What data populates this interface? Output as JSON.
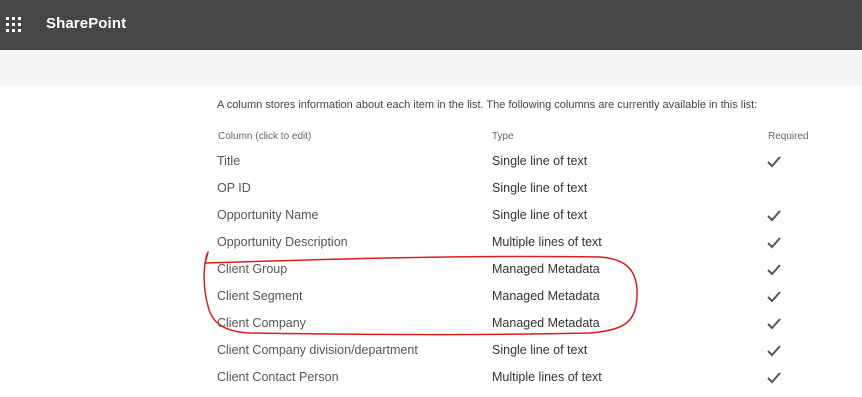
{
  "app": {
    "brand": "SharePoint",
    "launcher_icon": "app-launcher-waffle-icon"
  },
  "intro_text": "A column stores information about each item in the list. The following columns are currently available in this list:",
  "table": {
    "headers": {
      "column": "Column (click to edit)",
      "type": "Type",
      "required": "Required"
    },
    "rows": [
      {
        "name": "Title",
        "type": "Single line of text",
        "required": true
      },
      {
        "name": "OP ID",
        "type": "Single line of text",
        "required": false
      },
      {
        "name": "Opportunity Name",
        "type": "Single line of text",
        "required": true
      },
      {
        "name": "Opportunity Description",
        "type": "Multiple lines of text",
        "required": true
      },
      {
        "name": "Client Group",
        "type": "Managed Metadata",
        "required": true
      },
      {
        "name": "Client Segment",
        "type": "Managed Metadata",
        "required": true
      },
      {
        "name": "Client Company",
        "type": "Managed Metadata",
        "required": true
      },
      {
        "name": "Client Company division/department",
        "type": "Single line of text",
        "required": true
      },
      {
        "name": "Client Contact Person",
        "type": "Multiple lines of text",
        "required": true
      }
    ]
  },
  "colors": {
    "suitebar": "#484644",
    "annotation": "#d91e1e",
    "checkmark": "#555555"
  }
}
